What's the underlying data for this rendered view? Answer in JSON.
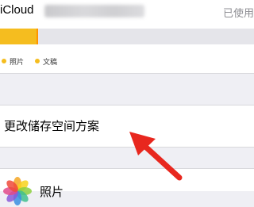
{
  "header": {
    "title": "iCloud",
    "used_label": "已使用"
  },
  "storage": {
    "legend": [
      {
        "label": "照片",
        "color": "#f5bd1f"
      },
      {
        "label": "文稿",
        "color": "#f5bd1f"
      }
    ]
  },
  "change_plan": {
    "label": "更改储存空间方案"
  },
  "apps": [
    {
      "label": "照片",
      "icon": "photos-icon"
    }
  ],
  "colors": {
    "bar_fill": "#f5bd1f",
    "bar_tick": "#ff9500",
    "arrow": "#e8271e"
  }
}
